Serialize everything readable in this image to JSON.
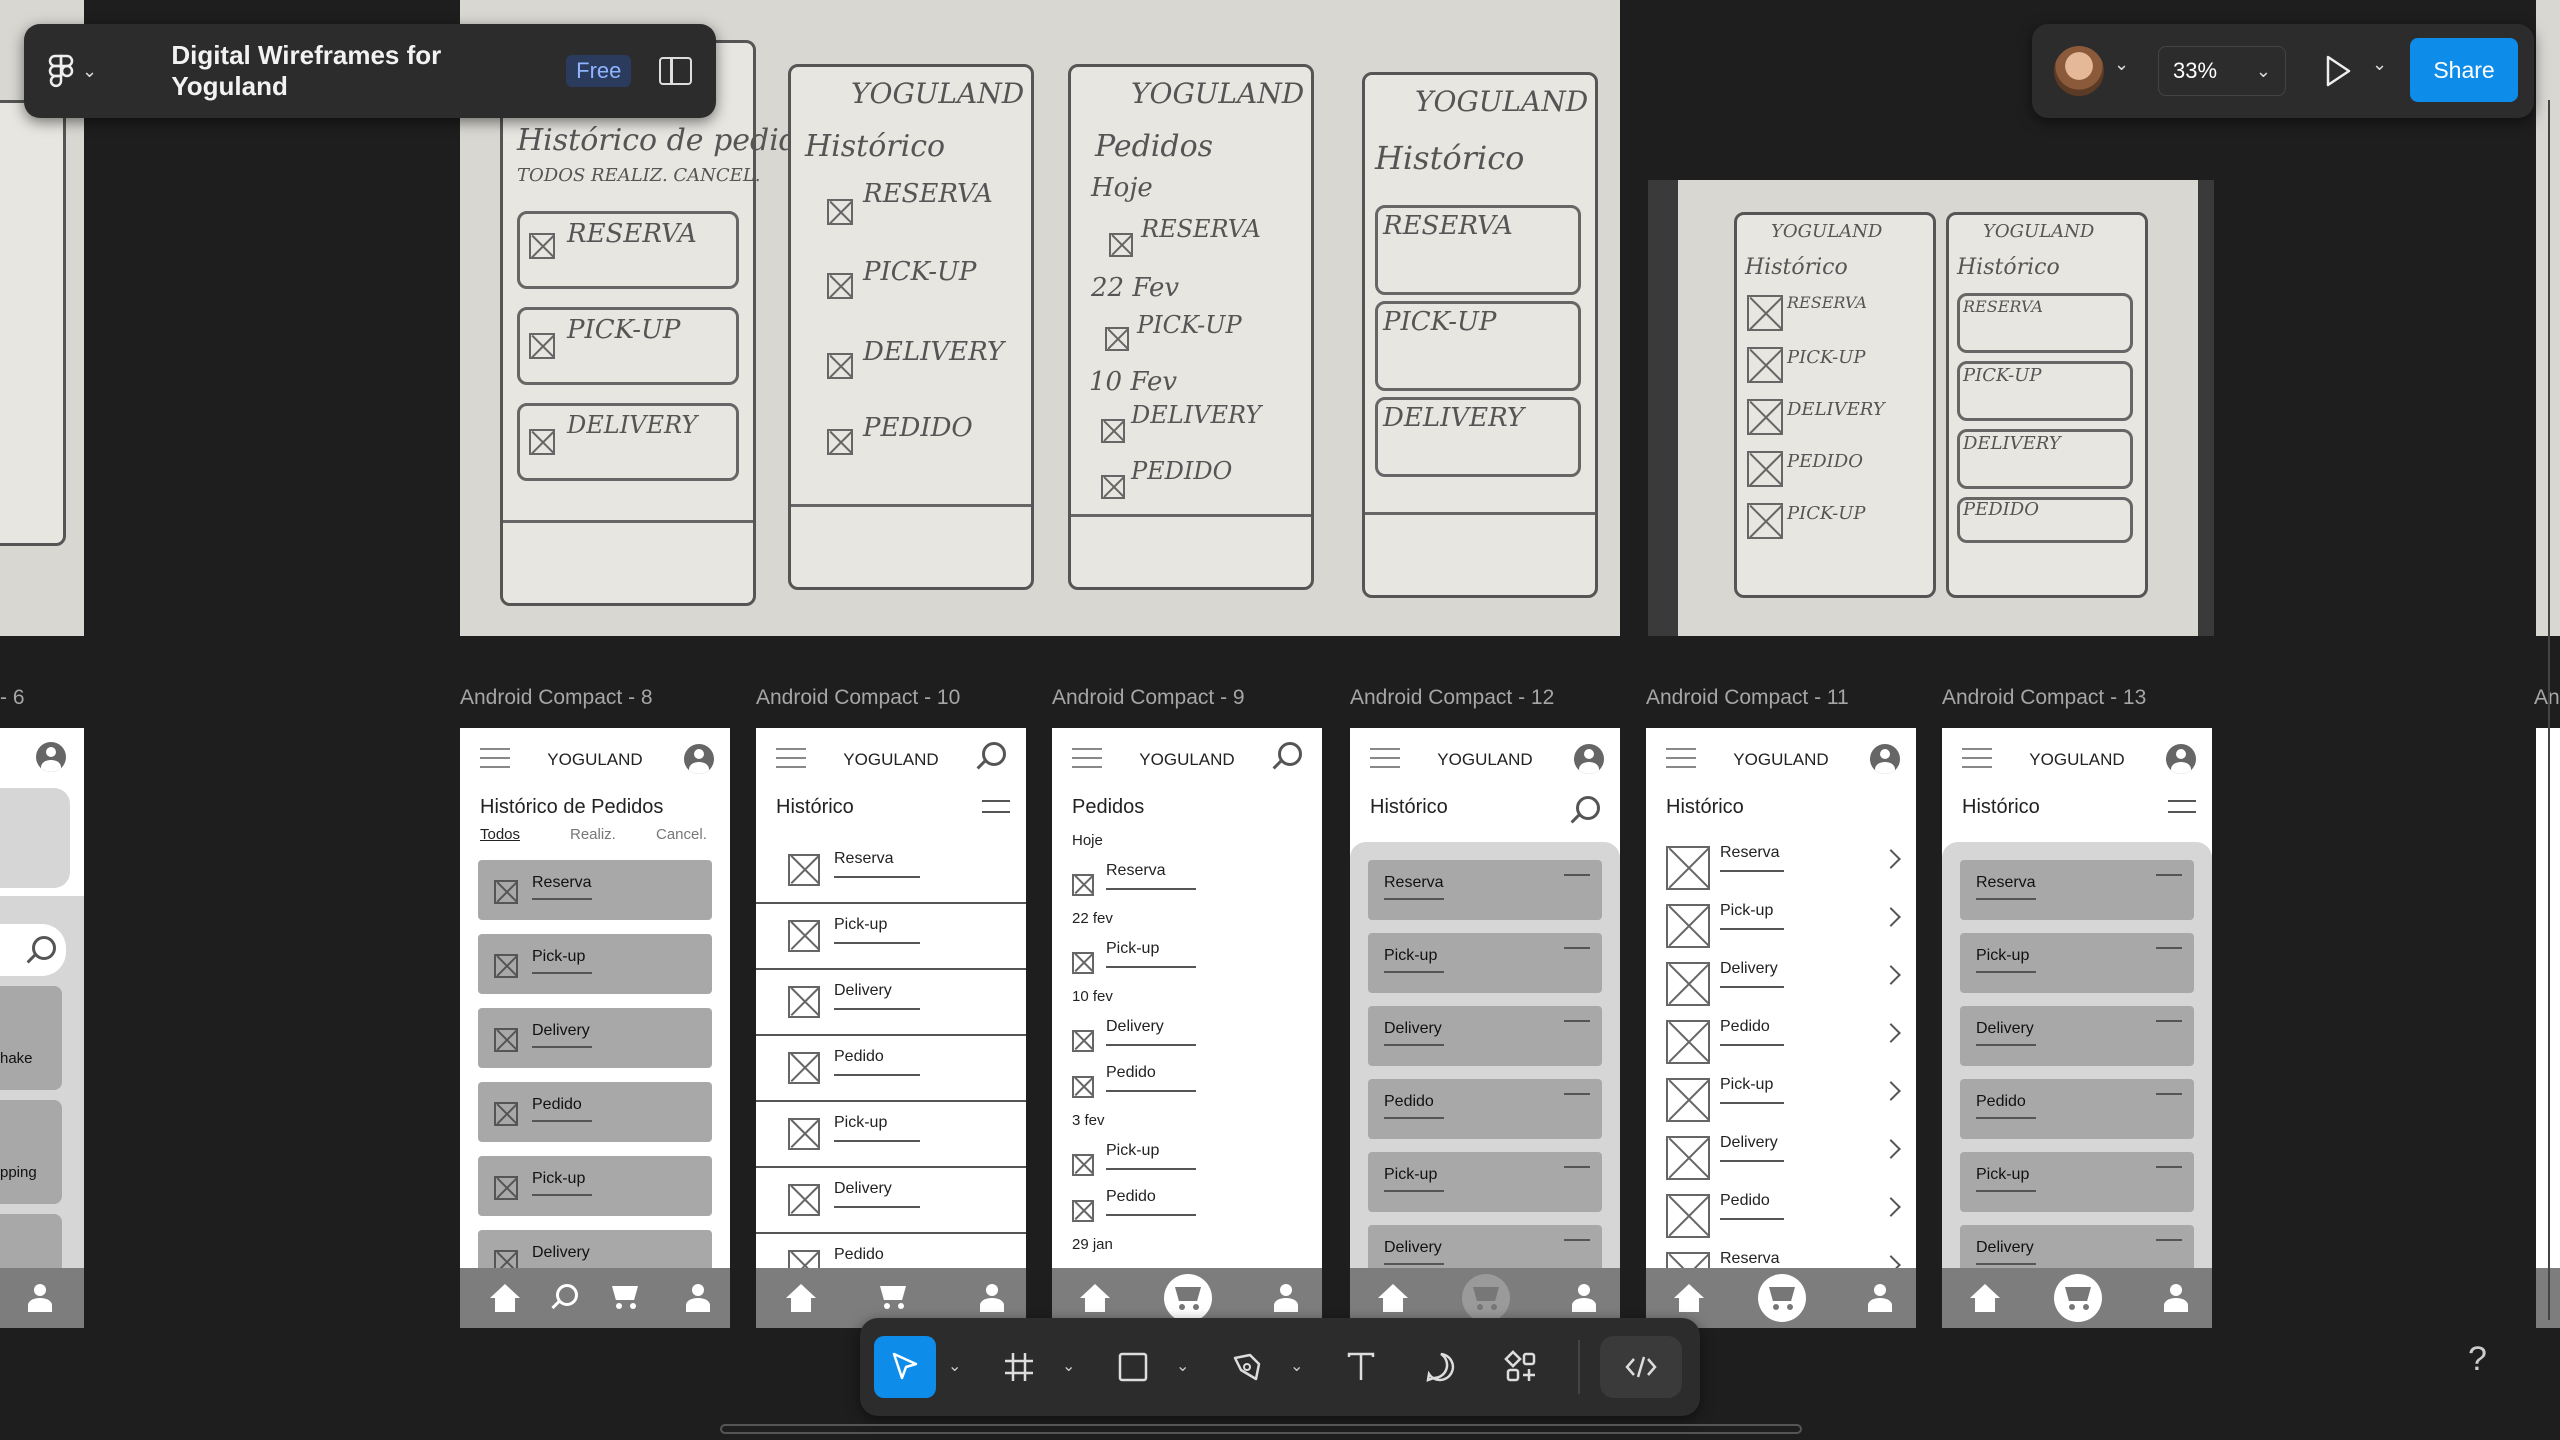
{
  "file": {
    "name": "Digital Wireframes for Yoguland",
    "plan_badge": "Free"
  },
  "topbar": {
    "zoom": "33%",
    "share_label": "Share"
  },
  "sketch": {
    "brand": "YOGULAND",
    "s1": {
      "title": "Histórico de pedidos",
      "tabs": "TODOS  REALIZ. CANCEL.",
      "items": [
        "RESERVA",
        "PICK-UP",
        "DELIVERY"
      ]
    },
    "s2": {
      "title": "Histórico",
      "items": [
        "RESERVA",
        "PICK-UP",
        "DELIVERY",
        "PEDIDO"
      ]
    },
    "s3": {
      "title": "Pedidos",
      "sub": "Hoje",
      "items": [
        "RESERVA",
        "PICK-UP",
        "DELIVERY",
        "PEDIDO"
      ],
      "dates": [
        "22 Fev",
        "10 Fev"
      ]
    },
    "s4": {
      "title": "Histórico",
      "items": [
        "RESERVA",
        "PICK-UP",
        "DELIVERY"
      ]
    },
    "s5": {
      "title": "Histórico",
      "items": [
        "RESERVA",
        "PICK-UP",
        "DELIVERY",
        "PEDIDO",
        "PICK-UP"
      ]
    },
    "s6": {
      "title": "Histórico",
      "items": [
        "RESERVA",
        "PICK-UP",
        "DELIVERY",
        "PEDIDO"
      ]
    }
  },
  "left_partial": {
    "label": "- 6",
    "items": [
      "hake",
      "pping"
    ]
  },
  "frames": [
    {
      "label": "Android Compact - 8",
      "brand": "YOGULAND",
      "title": "Histórico de Pedidos",
      "tabs": [
        "Todos",
        "Realiz.",
        "Cancel."
      ],
      "items": [
        "Reserva",
        "Pick-up",
        "Delivery",
        "Pedido",
        "Pick-up",
        "Delivery"
      ]
    },
    {
      "label": "Android Compact - 10",
      "brand": "YOGULAND",
      "title": "Histórico",
      "items": [
        "Reserva",
        "Pick-up",
        "Delivery",
        "Pedido",
        "Pick-up",
        "Delivery",
        "Pedido"
      ]
    },
    {
      "label": "Android Compact - 9",
      "brand": "YOGULAND",
      "title": "Pedidos",
      "dates": [
        "Hoje",
        "22 fev",
        "10 fev",
        "3 fev",
        "29 jan"
      ],
      "items": [
        "Reserva",
        "Pick-up",
        "Delivery",
        "Pedido",
        "Pick-up",
        "Pedido"
      ]
    },
    {
      "label": "Android Compact - 12",
      "brand": "YOGULAND",
      "title": "Histórico",
      "items": [
        "Reserva",
        "Pick-up",
        "Delivery",
        "Pedido",
        "Pick-up",
        "Delivery"
      ]
    },
    {
      "label": "Android Compact - 11",
      "brand": "YOGULAND",
      "title": "Histórico",
      "items": [
        "Reserva",
        "Pick-up",
        "Delivery",
        "Pedido",
        "Pick-up",
        "Delivery",
        "Pedido",
        "Reserva"
      ]
    },
    {
      "label": "Android Compact - 13",
      "brand": "YOGULAND",
      "title": "Histórico",
      "items": [
        "Reserva",
        "Pick-up",
        "Delivery",
        "Pedido",
        "Pick-up",
        "Delivery"
      ]
    }
  ],
  "right_partial_label": "An",
  "toolbar": {
    "tools": [
      "move-tool",
      "frame-tool",
      "rectangle-tool",
      "pen-tool",
      "text-tool",
      "comment-tool",
      "actions-tool",
      "dev-mode-toggle"
    ]
  },
  "help": "?",
  "colors": {
    "accent": "#0d8ce9",
    "canvas": "#1e1e1e"
  }
}
